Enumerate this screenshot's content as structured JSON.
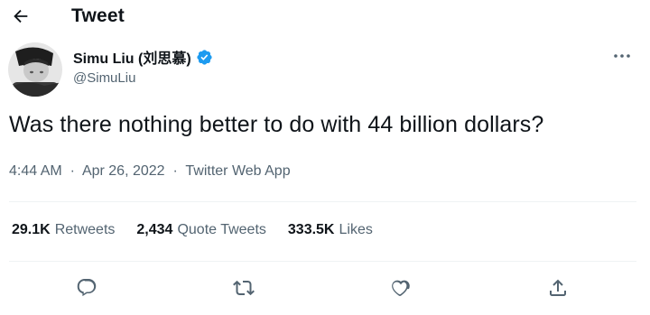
{
  "header": {
    "title": "Tweet",
    "back_icon": "arrow-left-icon"
  },
  "author": {
    "name": "Simu Liu (刘思慕)",
    "handle": "@SimuLiu",
    "verified": true,
    "verified_color": "#1d9bf0"
  },
  "tweet": {
    "text": "Was there nothing better to do with 44 billion dollars?",
    "time": "4:44 AM",
    "separator": "·",
    "date": "Apr 26, 2022",
    "source": "Twitter Web App"
  },
  "stats": {
    "retweets_count": "29.1K",
    "retweets_label": "Retweets",
    "quotes_count": "2,434",
    "quotes_label": "Quote Tweets",
    "likes_count": "333.5K",
    "likes_label": "Likes"
  },
  "actions": {
    "icons": [
      "reply-icon",
      "retweet-icon",
      "like-icon",
      "share-icon"
    ]
  },
  "colors": {
    "text_primary": "#0f1419",
    "text_secondary": "#536471",
    "divider": "#eff3f4",
    "accent": "#1d9bf0"
  }
}
